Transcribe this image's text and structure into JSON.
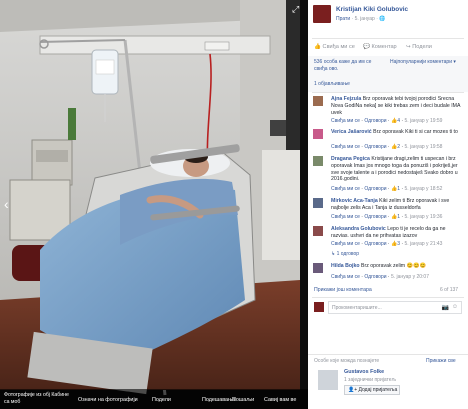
{
  "photo_bar": {
    "caption": "Фотографије из обј Кабине са моб",
    "tag": "Означи на фотографији",
    "share": "Подели",
    "download_options": "Подешавања",
    "send": "Пошаљи",
    "fullscreen_label": "Савиј вам ве"
  },
  "post": {
    "author": "Kristijan Kiki Golubovic",
    "meta_follow": "Прати",
    "meta_date": "5. јануар",
    "actions": {
      "like": "Свиђа ми се",
      "comment": "Коментар",
      "share": "Подели"
    },
    "likes_summary": "536 особа каже да им се свиђа ово.",
    "sort_label": "Најпопуларнији коментари",
    "shares": "1 објављивање"
  },
  "comments": [
    {
      "author": "Ajna Fejzula",
      "text": "Brz oporavak tebi tvojoj porodici Srecna Nova GodiNa neka] se kiki trebas zem i deci budale IMA uvek",
      "like": "Свиђа ми се",
      "reply": "Одговори",
      "likes": "4",
      "date": "5. јануар у 19:59",
      "color": "#9b6b4f"
    },
    {
      "author": "Verica Jašarović",
      "text": "Brz oporavak Kiki ti si car mozes ti to",
      "like": "Свиђа ми се",
      "reply": "Одговори",
      "likes": "2",
      "date": "5. јануар у 19:58",
      "color": "#c85a8a"
    },
    {
      "author": "Dragana Pegica",
      "text": "Kristijane dragi,zelim ti uspecan i brz oporavak Imas jos mnogo toga da ponuziš i pokriješ,jer sve svoje talente a i porodici nedostaješ Svako dobro u 2016.godini.",
      "like": "Свиђа ми се",
      "reply": "Одговори",
      "likes": "1",
      "date": "5. јануар у 18:52",
      "color": "#7a8a6a"
    },
    {
      "author": "Mirkovic Aca-Tanja",
      "text": "Kiki zelim ti Brz oporavak i sve najbolje zelis Aca i Tanja iz dusseldorfa",
      "like": "Свиђа ми се",
      "reply": "Одговори",
      "likes": "1",
      "date": "5. јануар у 19:36",
      "color": "#5a6a8a"
    },
    {
      "author": "Aleksandra Golubovic",
      "text": "Lepo ti je recelo da ga ne razvias. ushvri da ne prihvatas izazov",
      "like": "Свиђа ми се",
      "reply": "Одговори",
      "likes": "3",
      "date": "5. јануар у 21:43",
      "color": "#8a4a4a"
    },
    {
      "author": "Hilda Bojko",
      "text": "Brz oporavak zelim",
      "like": "Свиђа ми се",
      "reply": "Одговори",
      "likes": "",
      "date": "5. јануар у 20:07",
      "color": "#6a5a7a"
    }
  ],
  "replies_label": "1 одговор",
  "more_comments": "Прикажи још коментара",
  "comment_count": "6 of 137",
  "comment_placeholder": "Прокоментаришите...",
  "suggested": {
    "title": "Особе које можда познајете",
    "see_all": "Прикажи све",
    "name": "Gustavos Folke",
    "mutual": "1 заједнички пријатељ",
    "add_button": "Додај пријатеља"
  },
  "colors": {
    "link": "#365899",
    "fb_blue": "#4267b2",
    "green": "#42b72a"
  }
}
